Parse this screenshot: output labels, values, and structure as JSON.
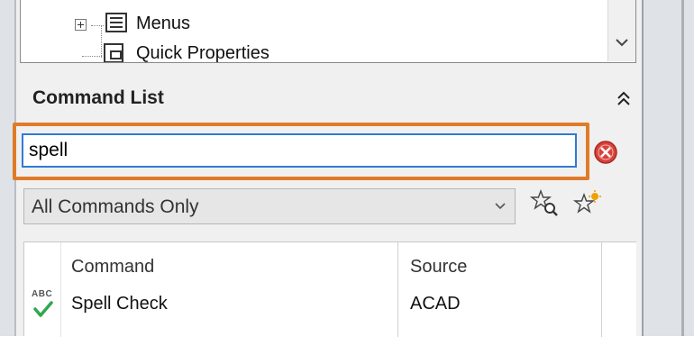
{
  "tree": {
    "items": [
      {
        "label": "Menus",
        "icon": "menu-icon"
      },
      {
        "label": "Quick Properties",
        "icon": "quick-properties-icon"
      }
    ]
  },
  "command_list": {
    "title": "Command List",
    "collapse_icon": "double-chevron-up-icon",
    "search": {
      "value": "spell",
      "placeholder": ""
    },
    "clear_icon": "clear-search-icon",
    "filter": {
      "selected": "All Commands Only",
      "options": [
        "All Commands Only"
      ]
    },
    "find_icon": "star-search-icon",
    "new_icon": "star-new-icon",
    "table": {
      "columns": [
        "Command",
        "Source"
      ],
      "rows": [
        {
          "icon": "spell-check-icon",
          "command": "Spell Check",
          "source": "ACAD"
        }
      ]
    }
  },
  "colors": {
    "highlight": "#e07b28",
    "focus_border": "#2f7bd4",
    "clear_red": "#d9413a",
    "check_green": "#2fa84f"
  }
}
